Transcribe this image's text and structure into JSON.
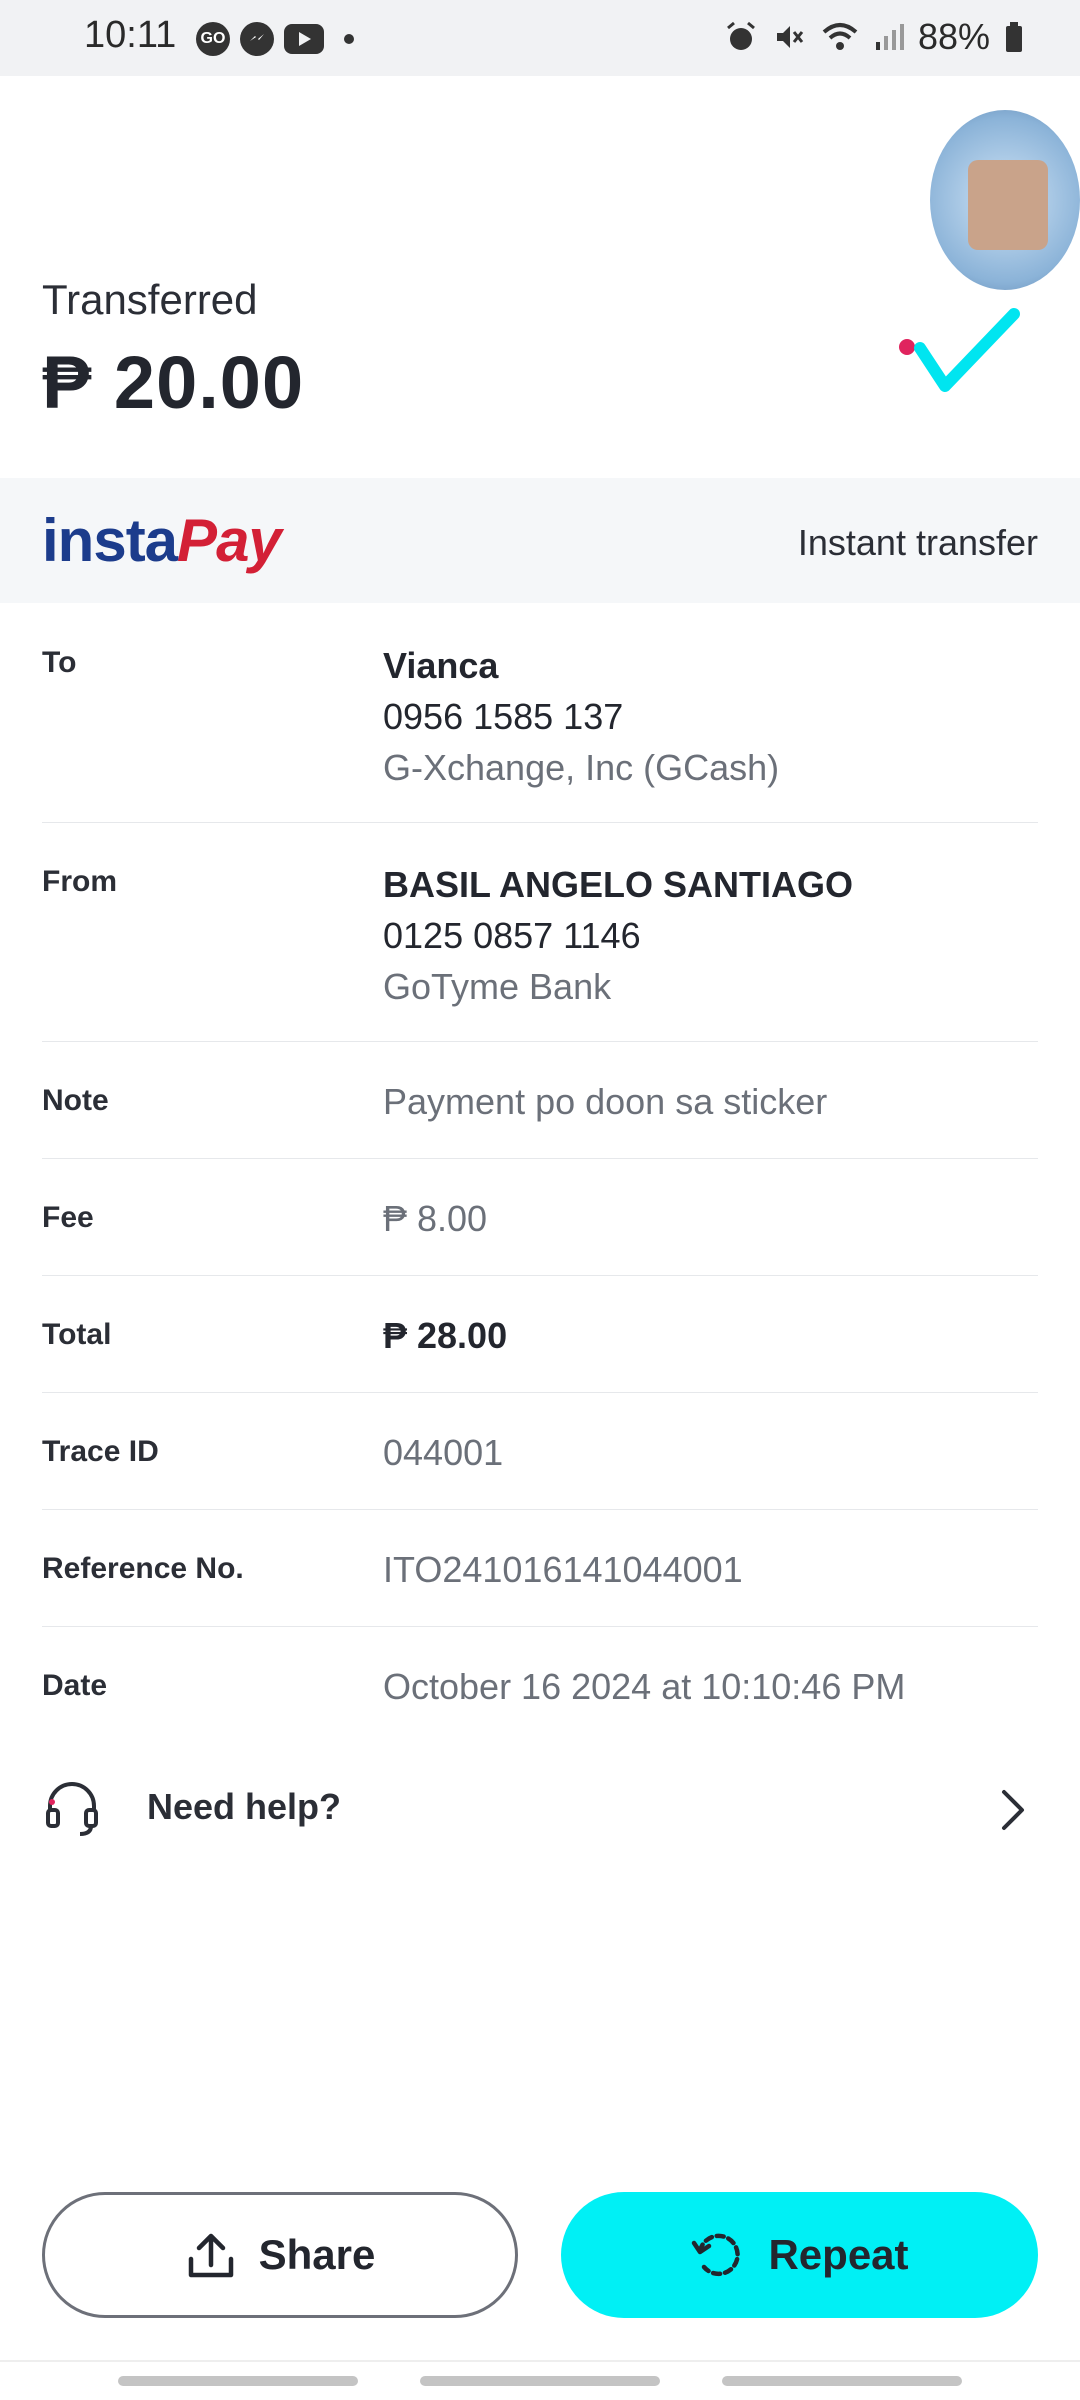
{
  "status": {
    "time": "10:11",
    "battery": "88%",
    "left_icons": [
      "go-icon",
      "messenger-icon",
      "youtube-icon",
      "dot-icon"
    ],
    "right_icons": [
      "alarm-icon",
      "mute-icon",
      "wifi-icon",
      "signal-icon",
      "battery-icon"
    ]
  },
  "header": {
    "label": "Transferred",
    "amount": "₱ 20.00",
    "status_icon": "check-icon",
    "accent_color": "#00e5f0",
    "dot_color": "#e0245e"
  },
  "provider": {
    "logo_part1": "insta",
    "logo_part2": "Pay",
    "type": "Instant transfer"
  },
  "details": {
    "to": {
      "label": "To",
      "name": "Vianca",
      "account": "0956 1585 137",
      "bank": "G-Xchange, Inc (GCash)"
    },
    "from": {
      "label": "From",
      "name": "BASIL ANGELO SANTIAGO",
      "account": "0125 0857 1146",
      "bank": "GoTyme Bank"
    },
    "note": {
      "label": "Note",
      "value": "Payment po doon sa sticker"
    },
    "fee": {
      "label": "Fee",
      "value": "₱ 8.00"
    },
    "total": {
      "label": "Total",
      "value": "₱ 28.00"
    },
    "trace": {
      "label": "Trace ID",
      "value": "044001"
    },
    "reference": {
      "label": "Reference No.",
      "value": "ITO241016141044001"
    },
    "date": {
      "label": "Date",
      "value": "October 16 2024 at 10:10:46 PM"
    }
  },
  "help": {
    "label": "Need help?",
    "icon": "headset-icon"
  },
  "actions": {
    "share": "Share",
    "repeat": "Repeat",
    "repeat_color": "#00f0f5"
  }
}
